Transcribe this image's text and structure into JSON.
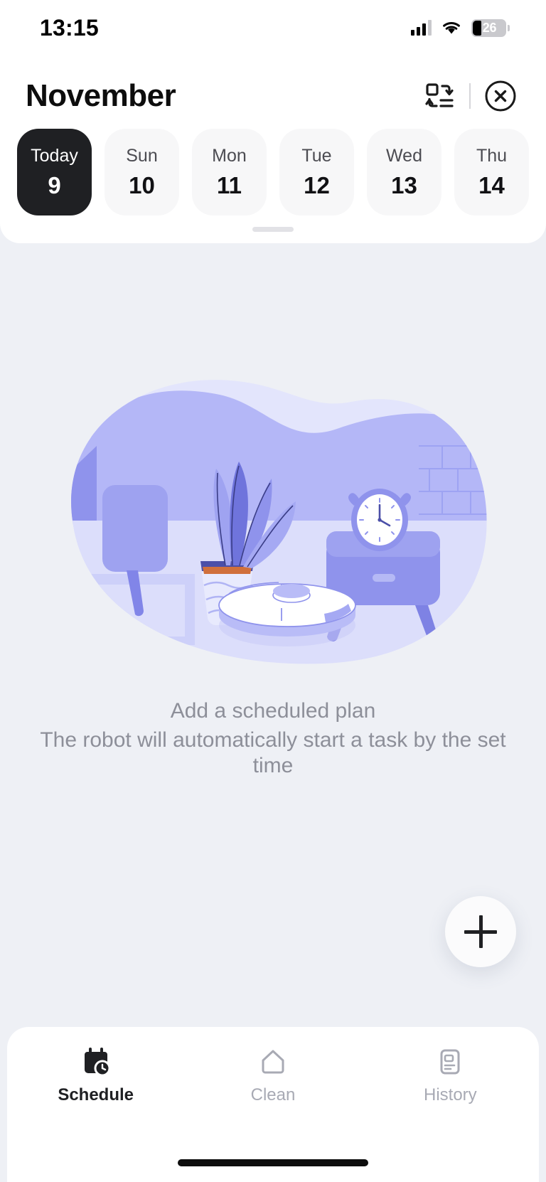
{
  "status_bar": {
    "time": "13:15",
    "battery_percent": "26",
    "signal_icon": "cellular-signal-icon",
    "wifi_icon": "wifi-icon",
    "battery_icon": "battery-icon"
  },
  "header": {
    "title": "November",
    "sort_icon": "reorder-sort-icon",
    "close_icon": "close-circle-icon"
  },
  "day_strip": {
    "days": [
      {
        "name": "Today",
        "number": "9",
        "active": true
      },
      {
        "name": "Sun",
        "number": "10",
        "active": false
      },
      {
        "name": "Mon",
        "number": "11",
        "active": false
      },
      {
        "name": "Tue",
        "number": "12",
        "active": false
      },
      {
        "name": "Wed",
        "number": "13",
        "active": false
      },
      {
        "name": "Thu",
        "number": "14",
        "active": false
      }
    ]
  },
  "empty_state": {
    "illustration": "robot-vacuum-room-illustration",
    "title": "Add a scheduled plan",
    "subtitle": "The robot will automatically start a task by the set time"
  },
  "fab": {
    "label": "+",
    "icon": "plus-icon"
  },
  "tabbar": {
    "items": [
      {
        "label": "Schedule",
        "icon": "calendar-clock-icon",
        "active": true
      },
      {
        "label": "Clean",
        "icon": "home-icon",
        "active": false
      },
      {
        "label": "History",
        "icon": "document-list-icon",
        "active": false
      }
    ]
  },
  "colors": {
    "background": "#eef0f5",
    "surface": "#ffffff",
    "active_chip": "#1f2023",
    "muted_text": "#8d8f99",
    "illustration_primary": "#8c8ff0",
    "illustration_light": "#b9bcf7",
    "illustration_pale": "#dcdefb",
    "illustration_pot": "#d0703c"
  }
}
